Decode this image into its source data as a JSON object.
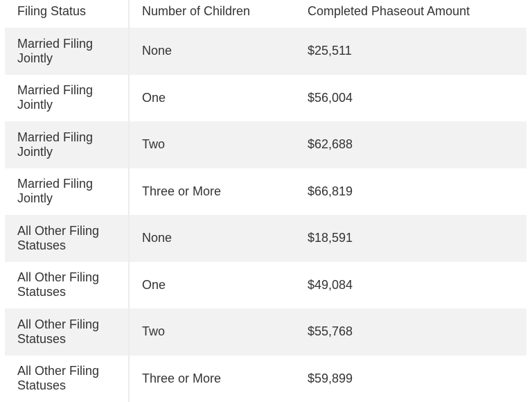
{
  "table": {
    "headers": [
      "Filing Status",
      "Number of Children",
      "Completed Phaseout Amount"
    ],
    "rows": [
      {
        "filing_status": "Married Filing Jointly",
        "children": "None",
        "amount": "$25,511"
      },
      {
        "filing_status": "Married Filing Jointly",
        "children": "One",
        "amount": "$56,004"
      },
      {
        "filing_status": "Married Filing Jointly",
        "children": "Two",
        "amount": "$62,688"
      },
      {
        "filing_status": "Married Filing Jointly",
        "children": "Three or More",
        "amount": "$66,819"
      },
      {
        "filing_status": "All Other Filing Statuses",
        "children": "None",
        "amount": "$18,591"
      },
      {
        "filing_status": "All Other Filing Statuses",
        "children": "One",
        "amount": "$49,084"
      },
      {
        "filing_status": "All Other Filing Statuses",
        "children": "Two",
        "amount": "$55,768"
      },
      {
        "filing_status": "All Other Filing Statuses",
        "children": "Three or More",
        "amount": "$59,899"
      }
    ]
  },
  "colors": {
    "stripe": "#f2f2f2",
    "text": "#333333",
    "divider": "#ececec"
  }
}
